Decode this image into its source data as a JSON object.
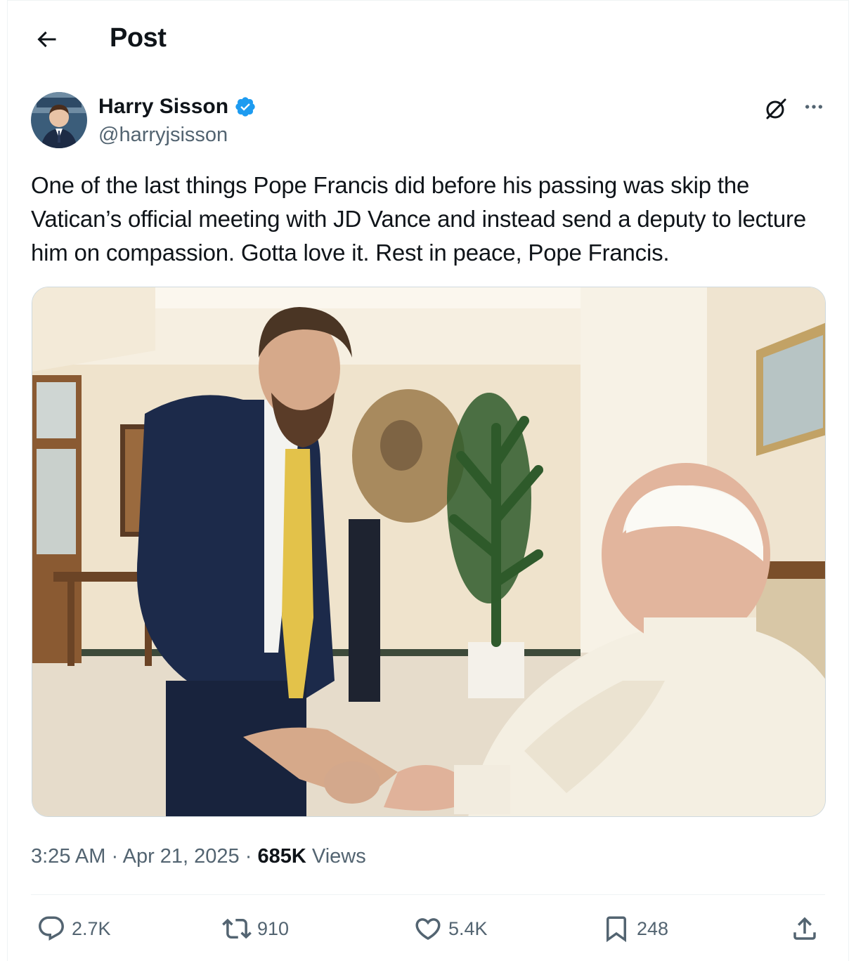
{
  "header": {
    "title": "Post",
    "back_icon": "arrow-left-icon"
  },
  "author": {
    "name": "Harry Sisson",
    "handle": "@harryjsisson",
    "verified": true,
    "verified_color": "#1d9bf0"
  },
  "post": {
    "text": "One of the last things Pope Francis did before his passing was skip the Vatican’s official meeting with JD Vance and instead send a deputy to lecture him on compassion. Gotta love it. Rest in peace, Pope Francis.",
    "time": "3:25 AM",
    "date": "Apr 21, 2025",
    "views_count": "685K",
    "views_label": "Views",
    "separator": "·"
  },
  "actions": {
    "replies": "2.7K",
    "reposts": "910",
    "likes": "5.4K",
    "bookmarks": "248"
  },
  "colors": {
    "text_primary": "#0f1419",
    "text_secondary": "#536471",
    "border": "#eff3f4",
    "accent": "#1d9bf0"
  }
}
